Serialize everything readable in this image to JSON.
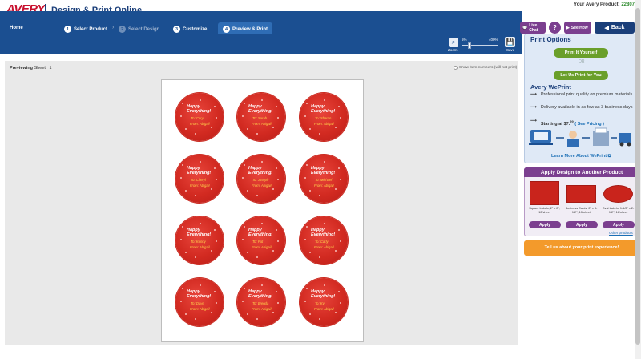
{
  "header": {
    "logo": "AVERY",
    "title": "Design & Print Online",
    "product_label": "Your Avery Product:",
    "product_number": "22807"
  },
  "nav": {
    "home": "Home",
    "steps": [
      {
        "num": "1",
        "label": "Select Product"
      },
      {
        "num": "2",
        "label": "Select Design"
      },
      {
        "num": "3",
        "label": "Customize"
      },
      {
        "num": "4",
        "label": "Preview & Print"
      }
    ],
    "live_chat": "Live Chat",
    "help": "?",
    "see_how": "See How",
    "back": "Back"
  },
  "toolbar": {
    "zoom_label": "Zoom",
    "zoom_min": "5%",
    "zoom_max": "400%",
    "save_label": "Save"
  },
  "preview": {
    "label_prefix": "Previewing",
    "label_sheet": "Sheet",
    "sheet_number": "1",
    "show_item_numbers": "Show item numbers (will not print)"
  },
  "labels": [
    {
      "line1": "Happy Everything!",
      "line2": "To: Cory",
      "line3": "From: Abigail"
    },
    {
      "line1": "Happy Everything!",
      "line2": "To: Sarah",
      "line3": "From: Abigail"
    },
    {
      "line1": "Happy Everything!",
      "line2": "To: Sharon",
      "line3": "From: Abigail"
    },
    {
      "line1": "Happy Everything!",
      "line2": "To: Cheryl",
      "line3": "From: Abigail"
    },
    {
      "line1": "Happy Everything!",
      "line2": "To: Joseph",
      "line3": "From: Abigail"
    },
    {
      "line1": "Happy Everything!",
      "line2": "To: Michael",
      "line3": "From: Abigail"
    },
    {
      "line1": "Happy Everything!",
      "line2": "To: Kenny",
      "line3": "From: Abigail"
    },
    {
      "line1": "Happy Everything!",
      "line2": "To: Pat",
      "line3": "From: Abigail"
    },
    {
      "line1": "Happy Everything!",
      "line2": "To: Carly",
      "line3": "From: Abigail"
    },
    {
      "line1": "Happy Everything!",
      "line2": "To: Dave",
      "line3": "From: Abigail"
    },
    {
      "line1": "Happy Everything!",
      "line2": "To: Brenda",
      "line3": "From: Abigail"
    },
    {
      "line1": "Happy Everything!",
      "line2": "To: Ky",
      "line3": "From: Abigail"
    }
  ],
  "print_options": {
    "title": "Print Options",
    "print_yourself": "Print It Yourself",
    "or": "OR",
    "let_us_print": "Let Us Print for You",
    "weprint_title": "Avery WePrint",
    "bullet1": "Professional print quality on premium materials",
    "bullet2": "Delivery available in as few as 3 business days",
    "bullet3_prefix": "Starting at $7.",
    "bullet3_cents": "99",
    "bullet3_link": "( See Pricing )",
    "learn_more": "Learn More About WePrint"
  },
  "apply_design": {
    "title": "Apply Design to Another Product",
    "products": [
      {
        "caption": "Square Labels, 2\" x 2\", 12/sheet",
        "button": "Apply"
      },
      {
        "caption": "Business Cards, 2\" x 3-1/2\", 10/sheet",
        "button": "Apply"
      },
      {
        "caption": "Oval Labels, 1-1/2\" x 2-1/2\", 18/sheet",
        "button": "Apply"
      }
    ],
    "other_products": "Other products"
  },
  "feedback": "Tell us about your print experience!",
  "colors": {
    "nav_blue": "#1b4f91",
    "brand_red": "#c8102e",
    "accent_purple": "#7b3f8f",
    "green_button": "#6a9f2a",
    "orange_feedback": "#f39a2b",
    "label_red": "#d22a21"
  }
}
